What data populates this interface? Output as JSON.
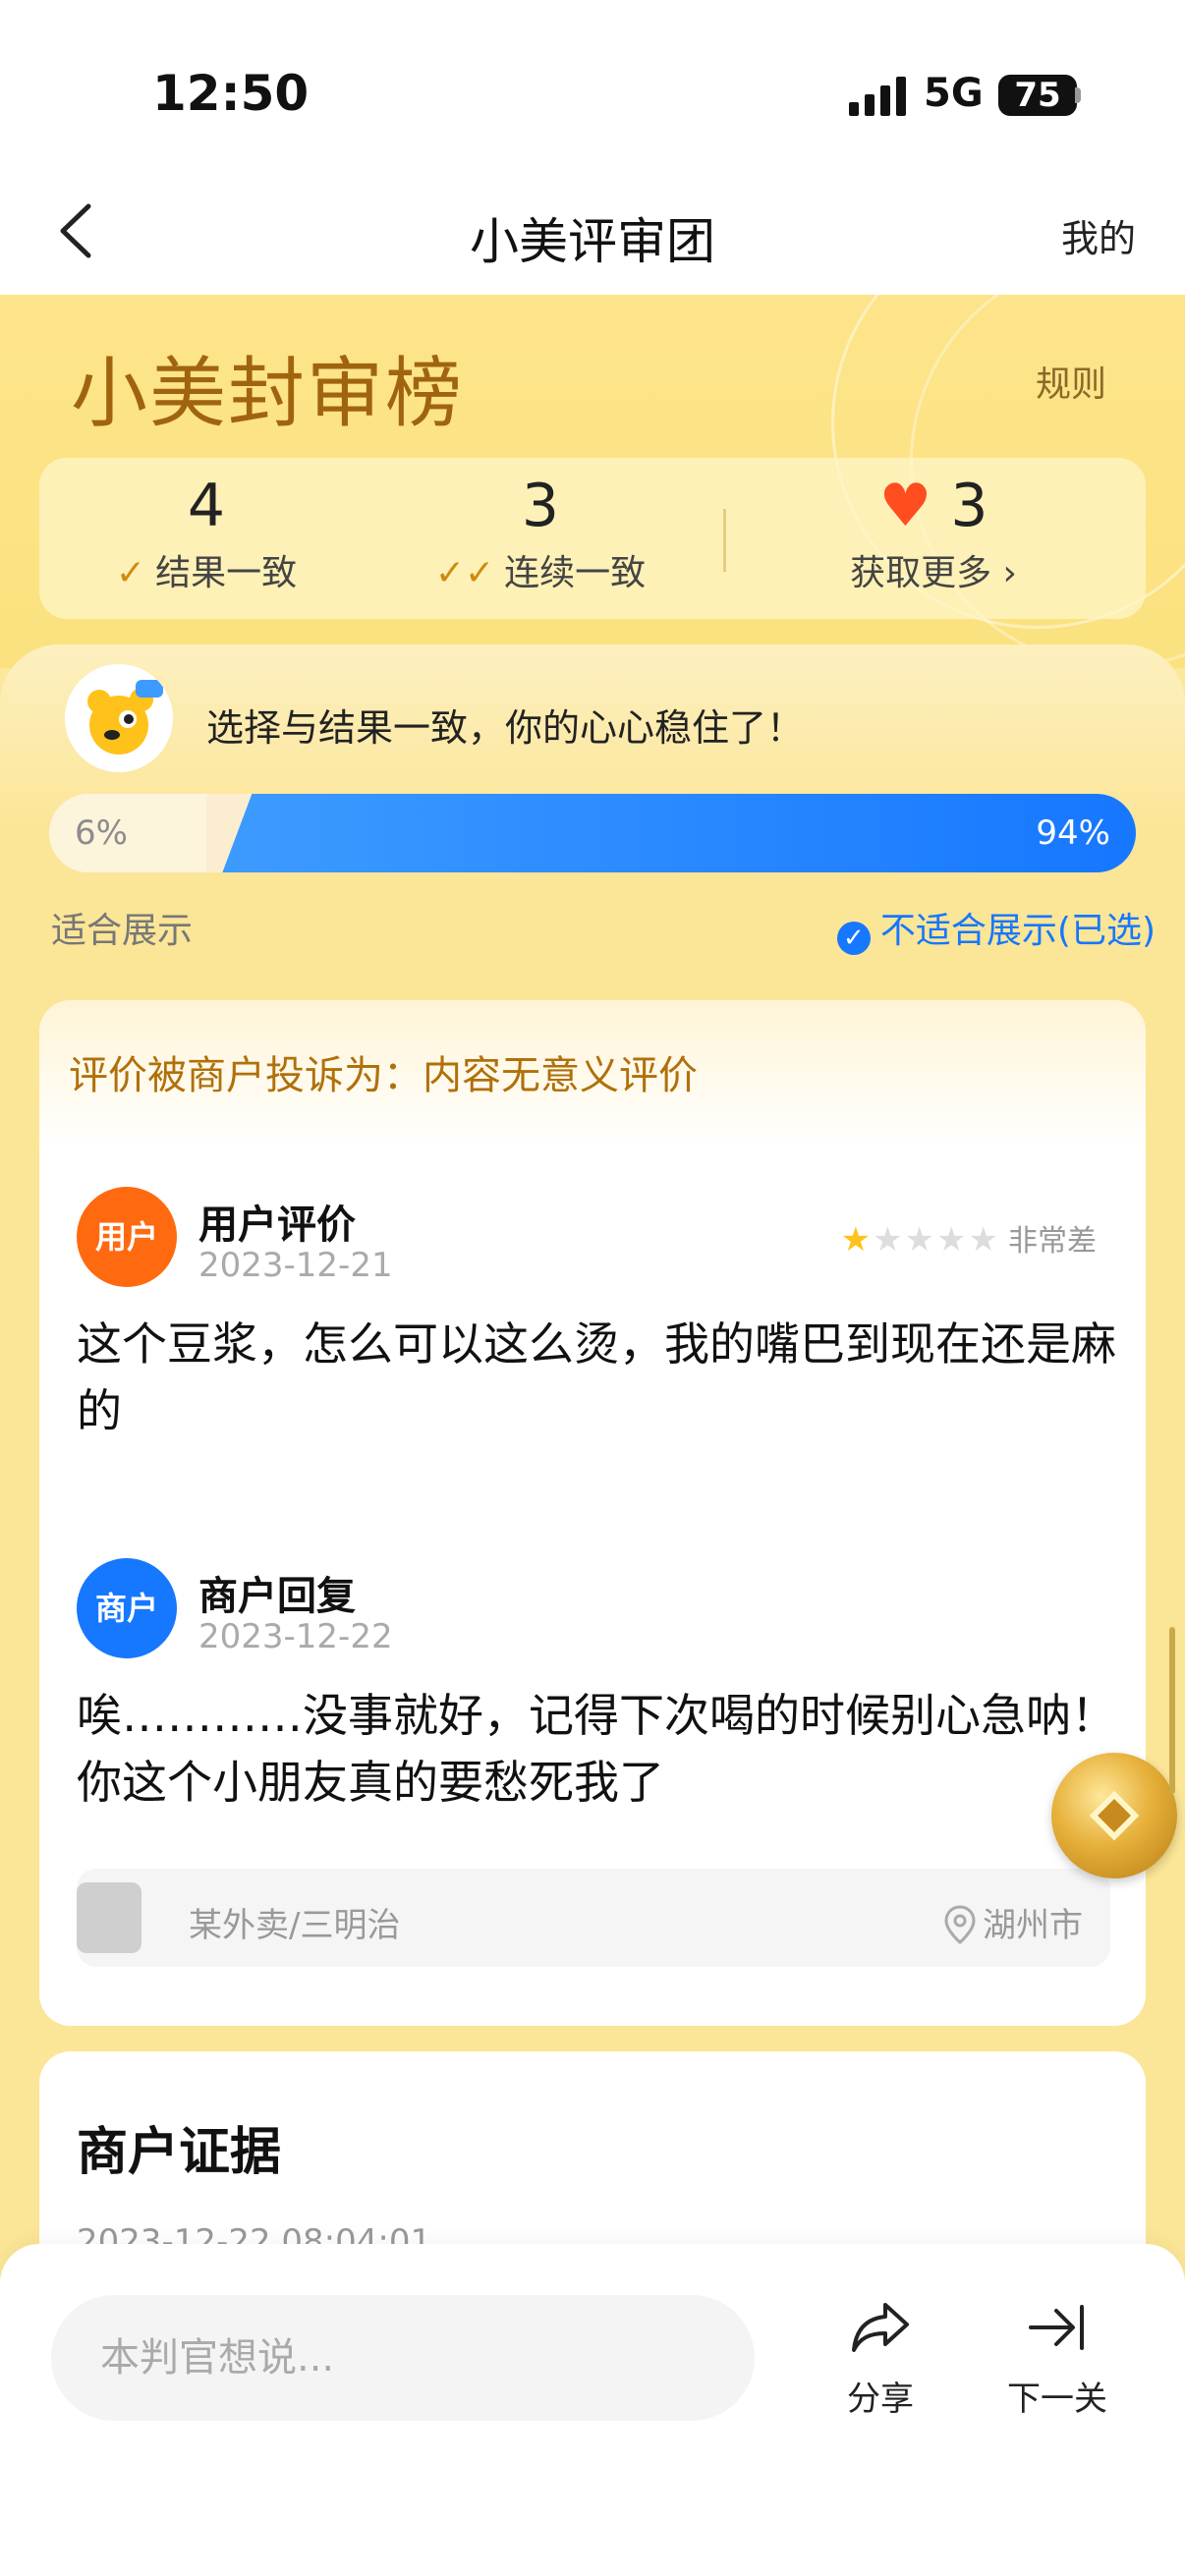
{
  "status_bar": {
    "time": "12:50",
    "network": "5G",
    "battery": "75"
  },
  "nav": {
    "title": "小美评审团",
    "right_label": "我的"
  },
  "banner": {
    "title": "小美封审榜",
    "rules_label": "规则"
  },
  "stats": [
    {
      "value": "4",
      "label": "结果一致",
      "icon": "check-icon"
    },
    {
      "value": "3",
      "label": "连续一致",
      "icon": "double-check-icon"
    },
    {
      "value": "3",
      "label": "获取更多",
      "icon": "heart-icon"
    }
  ],
  "result": {
    "tip": "选择与结果一致，你的心心稳住了！",
    "left_percent": "6%",
    "right_percent": "94%",
    "left_fraction": 0.06,
    "right_fraction": 0.94,
    "left_option": "适合展示",
    "right_option": "不适合展示(已选)"
  },
  "case": {
    "complaint": "评价被商户投诉为：内容无意义评价",
    "review": {
      "badge": "用户",
      "name": "用户评价",
      "date": "2023-12-21",
      "rating": 1,
      "rating_max": 5,
      "rating_label": "非常差",
      "text": "这个豆浆，怎么可以这么烫，我的嘴巴到现在还是麻的"
    },
    "reply": {
      "badge": "商户",
      "name": "商户回复",
      "date": "2023-12-22",
      "text": "唉…………没事就好，记得下次喝的时候别心急呐！你这个小朋友真的要愁死我了"
    },
    "shop": {
      "name": "某外卖/三明治",
      "location": "湖州市"
    }
  },
  "evidence": {
    "title": "商户证据",
    "date": "2023-12-22 08:04:01"
  },
  "bottom_bar": {
    "comment_placeholder": "本判官想说...",
    "share_label": "分享",
    "next_label": "下一关"
  },
  "colors": {
    "accent_blue": "#1677ff",
    "accent_orange": "#ff6a10",
    "brand_gold": "#a0640f"
  }
}
